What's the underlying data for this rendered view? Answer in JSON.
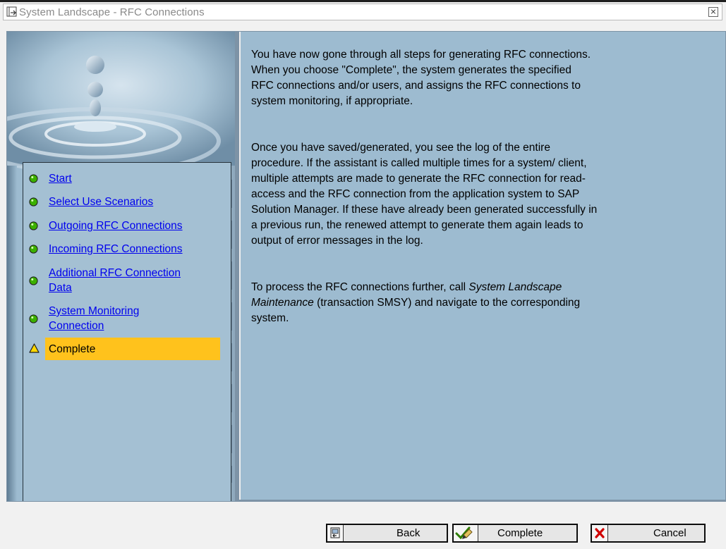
{
  "window": {
    "title": "System Landscape - RFC Connections"
  },
  "steps": [
    {
      "label": "Start",
      "status": "done",
      "icon": "green-dot-icon"
    },
    {
      "label": "Select Use Scenarios",
      "status": "done",
      "icon": "green-dot-icon"
    },
    {
      "label": "Outgoing RFC Connections",
      "status": "done",
      "icon": "green-dot-icon"
    },
    {
      "label": "Incoming RFC Connections",
      "status": "done",
      "icon": "green-dot-icon"
    },
    {
      "label_lines": [
        "Additional RFC Connection",
        "Data"
      ],
      "status": "done",
      "icon": "green-dot-icon"
    },
    {
      "label_lines": [
        "System Monitoring",
        "Connection"
      ],
      "status": "done",
      "icon": "green-dot-icon"
    },
    {
      "label": "Complete",
      "status": "current",
      "icon": "warning-triangle-icon"
    }
  ],
  "content": {
    "p1_lines": [
      "You have now gone through all steps for generating RFC connections.",
      "When you choose \"Complete\", the system generates the specified",
      "RFC connections and/or users, and assigns the RFC connections to",
      "system monitoring, if appropriate."
    ],
    "p2_lines": [
      "Once you have saved/generated, you see the log of the entire",
      "procedure. If the assistant is called multiple times for a system/ client,",
      "multiple attempts are made to generate the RFC connection for read-",
      "access and the RFC connection from the application system to SAP",
      "Solution Manager. If these have already been generated successfully in",
      "a previous run, the renewed attempt to generate them again leads to",
      "output of error messages in the log."
    ],
    "p3": {
      "line1_prefix": "To process the RFC connections further, call ",
      "line1_italic": "System Landscape",
      "line2_italic": "Maintenance",
      "line2_suffix": " (transaction SMSY) and navigate to the corresponding",
      "line3": "system."
    }
  },
  "buttons": {
    "back": {
      "label": "Back",
      "icon": "back-icon"
    },
    "complete": {
      "label": "Complete",
      "icon": "checkmark-icon"
    },
    "cancel": {
      "label": "Cancel",
      "icon": "cancel-x-icon"
    }
  },
  "colors": {
    "panel_blue": "#9dbbd0",
    "highlight": "#ffc21c",
    "link": "#0000ee",
    "status_done": "#3bb000",
    "status_current": "#ffd800"
  }
}
